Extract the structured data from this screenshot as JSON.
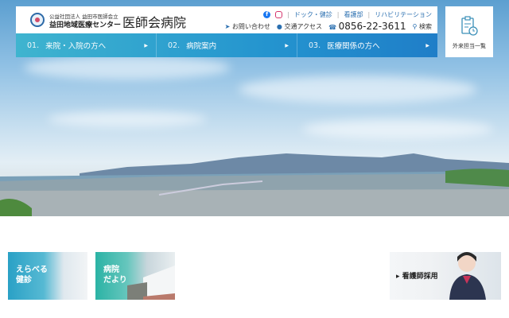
{
  "header": {
    "org_line": "公益社団法人 益田市医師会立",
    "center_name": "益田地域医療センター",
    "hospital_name": "医師会病院",
    "util_links": [
      "ドック・健診",
      "看護部",
      "リハビリテーション"
    ],
    "contact": "お問い合わせ",
    "access": "交通アクセス",
    "phone": "0856-22-3611",
    "search": "検索",
    "facebook_glyph": "f"
  },
  "nav": [
    {
      "num": "01.",
      "label": "来院・入院の方へ"
    },
    {
      "num": "02.",
      "label": "病院案内"
    },
    {
      "num": "03.",
      "label": "医療関係の方へ"
    }
  ],
  "outpatient": {
    "label": "外来担当一覧"
  },
  "banners": {
    "checkup": [
      "えらべる",
      "健診"
    ],
    "news": [
      "病院",
      "だより"
    ],
    "recruit": "看護師採用"
  },
  "colors": {
    "nav_start": "#3fb4cf",
    "nav_end": "#1f7ec8",
    "link": "#2a6fb0"
  }
}
